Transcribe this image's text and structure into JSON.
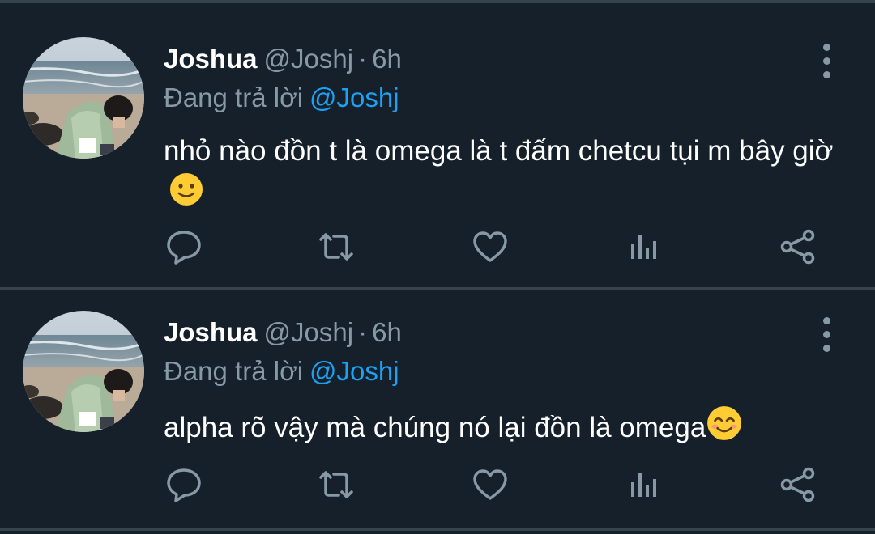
{
  "tweets": [
    {
      "display_name": "Joshua",
      "handle": "@Joshj",
      "separator": "·",
      "time": "6h",
      "reply_prefix": "Đang trả lời",
      "reply_handle": "@Joshj",
      "text": "nhỏ nào đồn t là omega là t đấm chetcu tụi m bây giờ",
      "emoji": "slightly-smiling-face"
    },
    {
      "display_name": "Joshua",
      "handle": "@Joshj",
      "separator": "·",
      "time": "6h",
      "reply_prefix": "Đang trả lời",
      "reply_handle": "@Joshj",
      "text": "alpha rõ vậy mà chúng nó lại đồn là omega",
      "emoji": "smiling-face-with-smiling-eyes"
    }
  ],
  "icons": {
    "reply": "reply-icon",
    "retweet": "retweet-icon",
    "like": "heart-icon",
    "stats": "analytics-icon",
    "share": "share-icon",
    "more": "more-vertical-icon"
  },
  "colors": {
    "background": "#15202b",
    "divider": "#38444d",
    "text": "#ffffff",
    "secondary": "#8899a6",
    "link": "#1da1f2"
  }
}
